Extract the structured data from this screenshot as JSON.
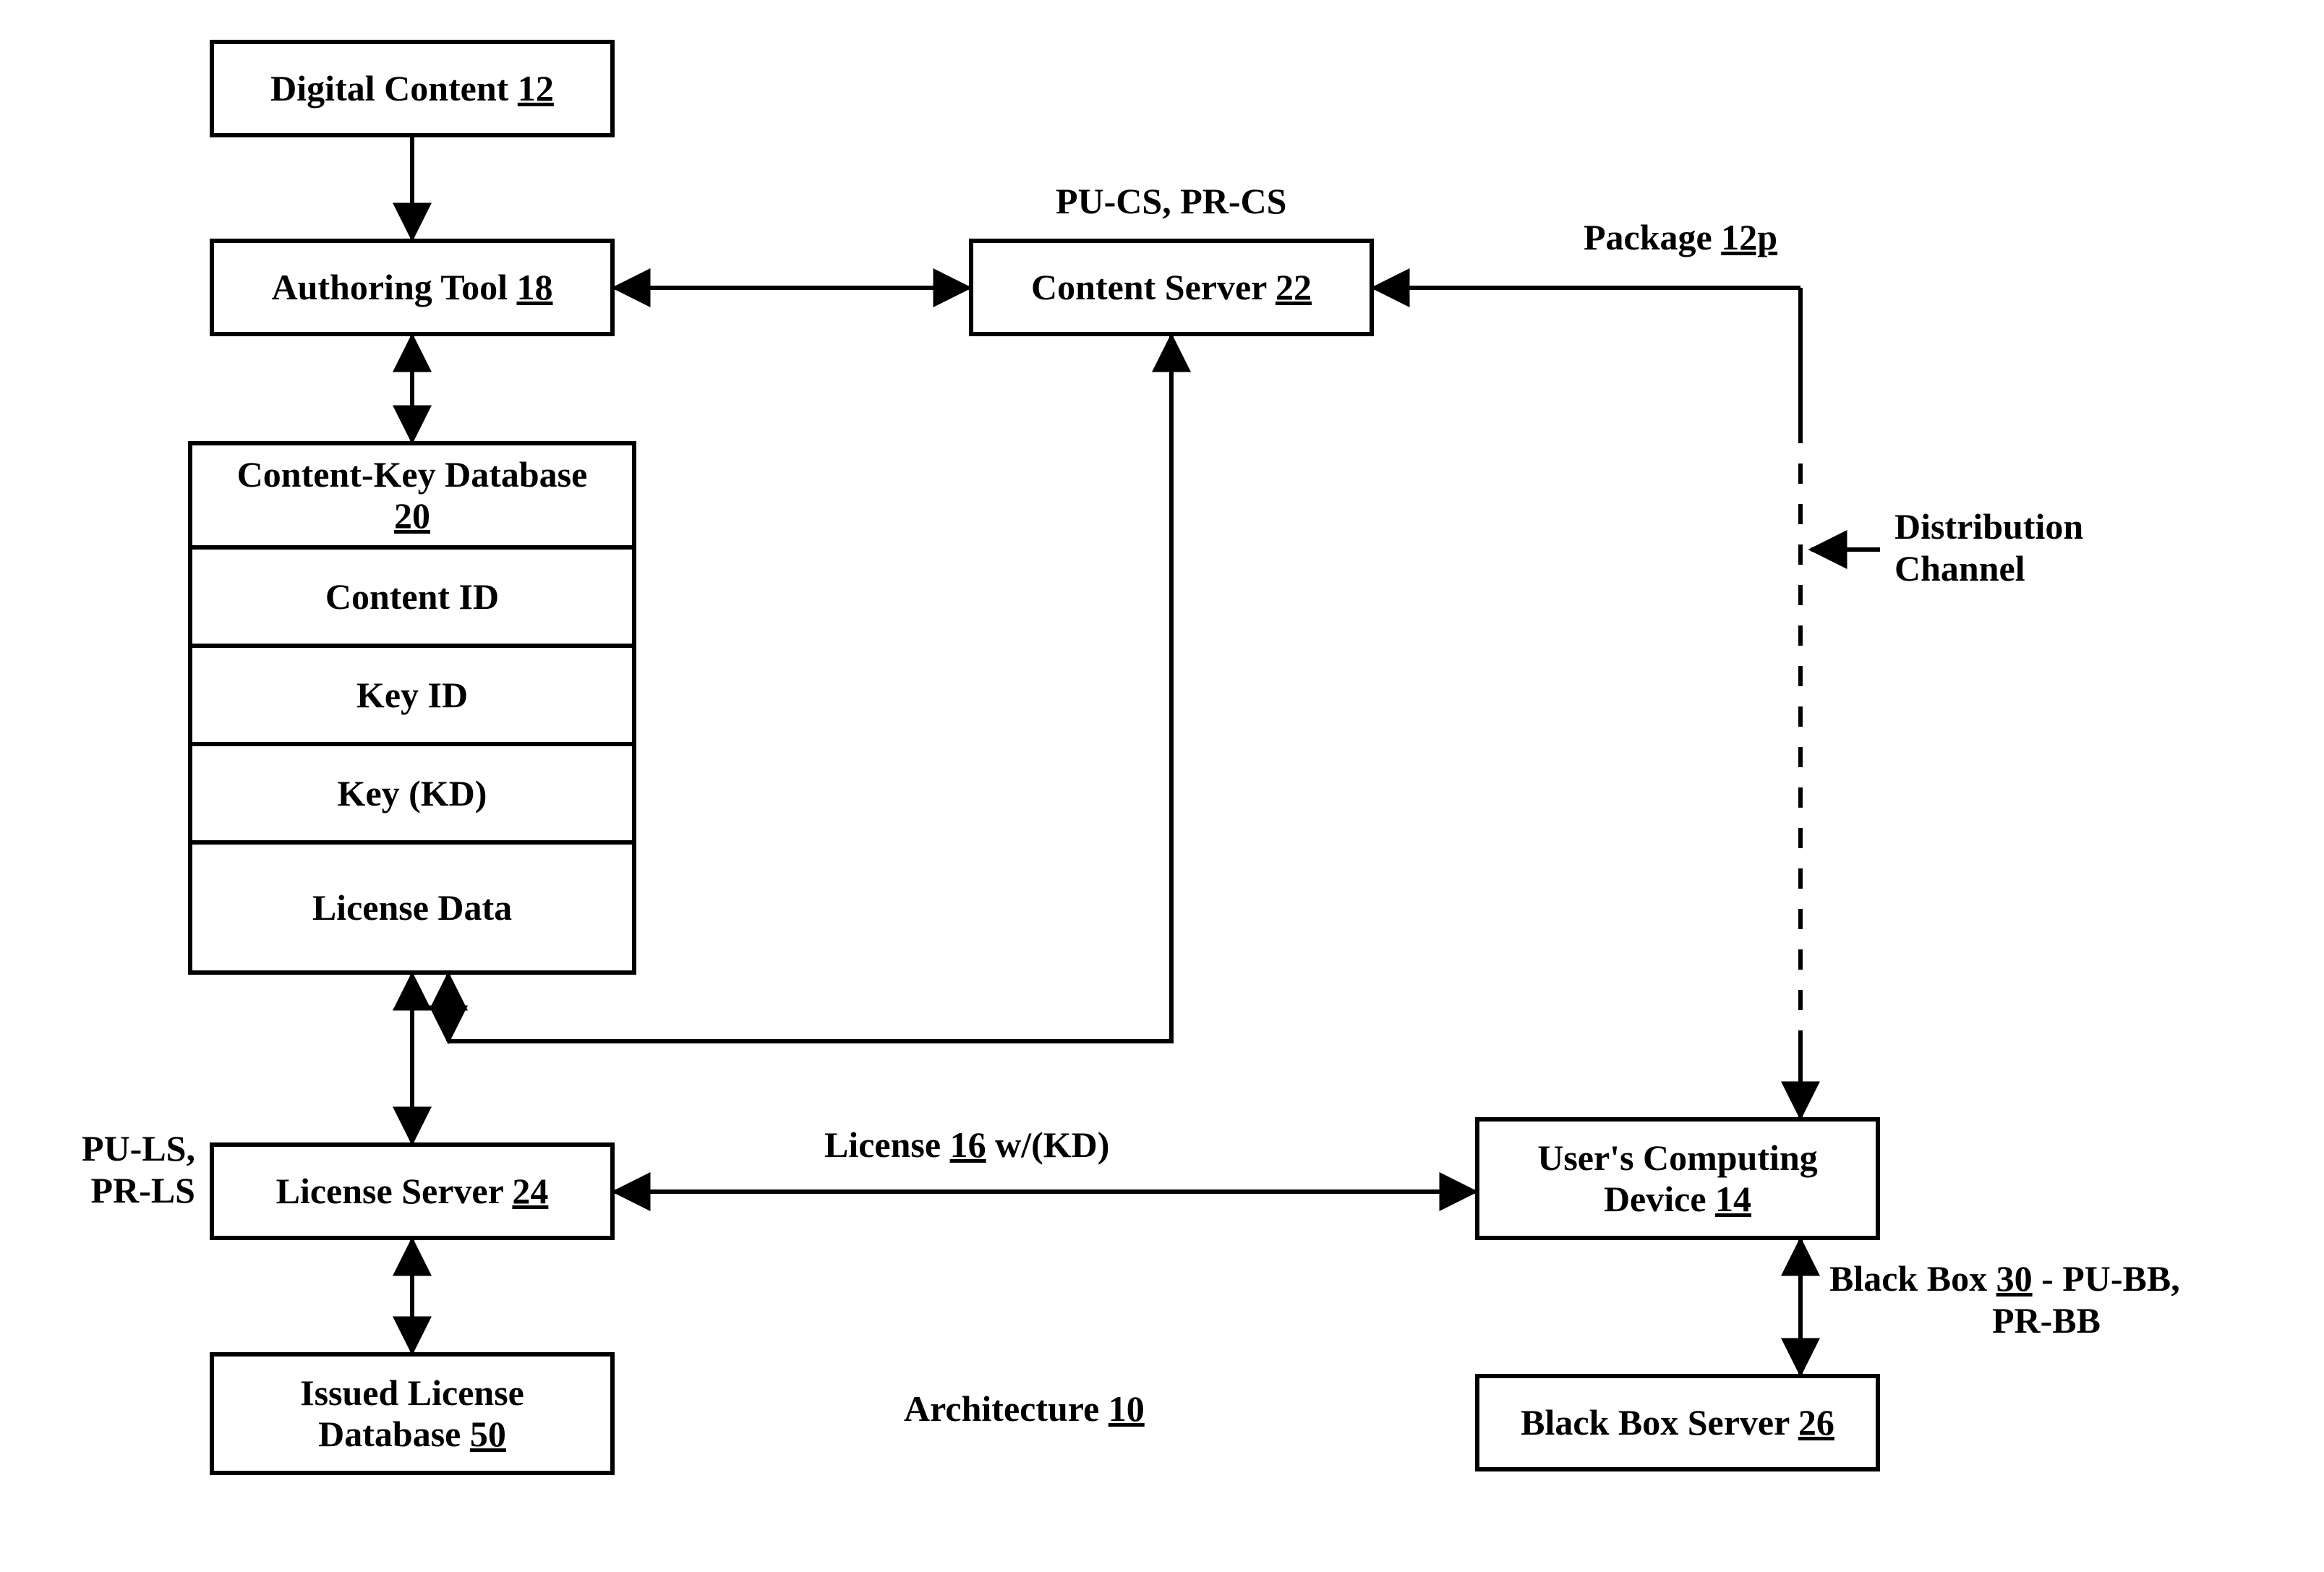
{
  "boxes": {
    "digital_content": {
      "text": "Digital Content",
      "num": "12"
    },
    "authoring_tool": {
      "text": "Authoring Tool",
      "num": "18"
    },
    "content_server": {
      "text": "Content Server",
      "num": "22"
    },
    "license_server": {
      "text": "License Server",
      "num": "24"
    },
    "users_device_line1": "User's Computing",
    "users_device_line2_pre": "Device",
    "users_device_num": "14",
    "issued_license_line1": "Issued License",
    "issued_license_line2_pre": "Database",
    "issued_license_num": "50",
    "blackbox_server": {
      "text": "Black Box Server",
      "num": "26"
    }
  },
  "db": {
    "header_text": "Content-Key Database",
    "header_num": "20",
    "rows": [
      "Content ID",
      "Key ID",
      "Key (KD)",
      "License Data"
    ]
  },
  "labels": {
    "pu_pr_cs": "PU-CS, PR-CS",
    "package_pre": "Package",
    "package_num": "12p",
    "distribution_channel_l1": "Distribution",
    "distribution_channel_l2": "Channel",
    "pu_pr_ls_l1": "PU-LS,",
    "pu_pr_ls_l2": "PR-LS",
    "license_pre": "License",
    "license_num": "16",
    "license_post": "w/(KD)",
    "blackbox_pre": "Black Box",
    "blackbox_num": "30",
    "blackbox_post": "- PU-BB,",
    "blackbox_l2": "PR-BB",
    "architecture_pre": "Architecture",
    "architecture_num": "10"
  }
}
